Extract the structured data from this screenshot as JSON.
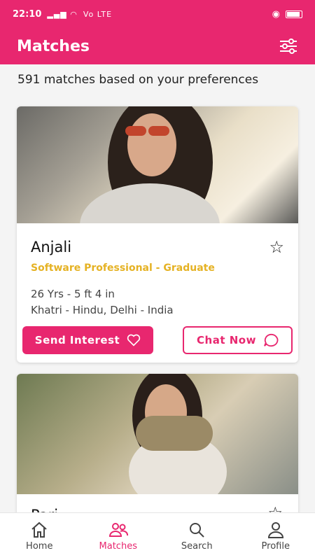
{
  "status_bar": {
    "time": "22:10",
    "network": "Vo LTE"
  },
  "app_bar": {
    "title": "Matches",
    "filter_icon": "sliders-icon"
  },
  "matches_count_text": "591 matches based on your preferences",
  "cards": [
    {
      "name": "Anjali",
      "profession": "Software Professional - Graduate",
      "age_height": "26 Yrs - 5 ft 4 in",
      "community_location": "Khatri - Hindu, Delhi - India",
      "interest_label": "Send Interest",
      "chat_label": "Chat Now"
    },
    {
      "name": "Pari"
    }
  ],
  "bottom_nav": [
    {
      "label": "Home",
      "icon": "home-icon"
    },
    {
      "label": "Matches",
      "icon": "people-icon",
      "active": true
    },
    {
      "label": "Search",
      "icon": "search-icon"
    },
    {
      "label": "Profile",
      "icon": "person-icon"
    }
  ],
  "colors": {
    "primary": "#e8276f",
    "accent": "#e5b224"
  }
}
